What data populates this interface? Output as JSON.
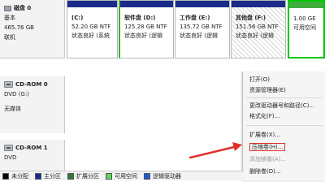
{
  "disks": [
    {
      "name": "磁盘 0",
      "type": "基本",
      "size": "465.76 GB",
      "status": "联机",
      "partitions": [
        {
          "title": "(C:)",
          "size": "52.20 GB NTF",
          "status": "状态良好 (系统"
        },
        {
          "title": "软件盘 (D:)",
          "size": "125.28 GB NTF",
          "status": "状态良好 (逻辑"
        },
        {
          "title": "工作盘 (E:)",
          "size": "135.72 GB NTF",
          "status": "状态良好 (逻辑"
        },
        {
          "title": "其他盘 (F:)",
          "size": "151.56 GB NTF",
          "status": "状态良好 (逻辑"
        },
        {
          "title": "",
          "size": "1.00 GE",
          "status": "可用空间"
        }
      ]
    },
    {
      "name": "CD-ROM 0",
      "type": "DVD (G:)",
      "status": "无媒体"
    },
    {
      "name": "CD-ROM 1",
      "type": "DVD"
    }
  ],
  "context_menu": {
    "items": [
      {
        "label": "打开(O)",
        "disabled": false
      },
      {
        "label": "资源管理器(E)",
        "disabled": false
      },
      {
        "label": "更改驱动器号和路径(C)...",
        "disabled": false
      },
      {
        "label": "格式化(F)...",
        "disabled": false
      },
      {
        "label": "扩展卷(X)...",
        "disabled": false
      },
      {
        "label": "压缩卷(H)...",
        "disabled": false,
        "highlighted": true
      },
      {
        "label": "添加镜像(A)...",
        "disabled": true
      },
      {
        "label": "删除卷(D)...",
        "disabled": false
      }
    ]
  },
  "legend": [
    {
      "label": "未分配",
      "color": "#000000"
    },
    {
      "label": "主分区",
      "color": "#1a2b8a"
    },
    {
      "label": "扩展分区",
      "color": "#2e7d32"
    },
    {
      "label": "可用空间",
      "color": "#5cd65c"
    },
    {
      "label": "逻辑驱动器",
      "color": "#1e5bd6"
    }
  ],
  "colors": {
    "primary": "#1a2b8a",
    "free": "#3fae3f",
    "highlight_border": "#e0322b"
  }
}
